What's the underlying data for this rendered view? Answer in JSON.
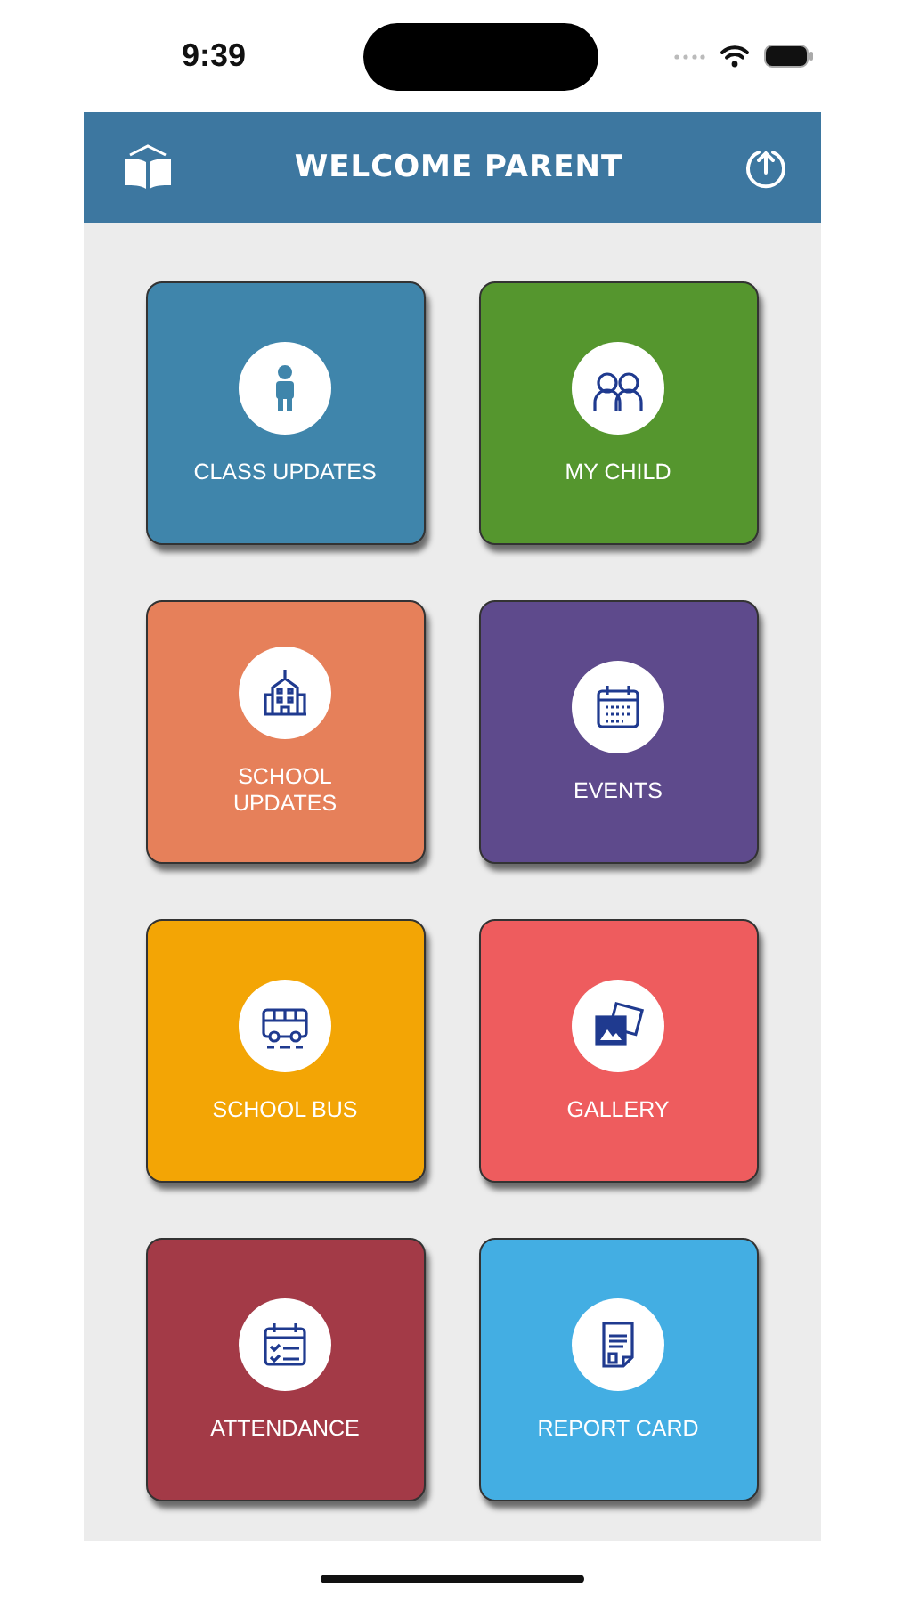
{
  "status_bar": {
    "time": "9:39"
  },
  "header": {
    "title": "WELCOME PARENT"
  },
  "tiles": [
    {
      "label": "CLASS UPDATES",
      "color": "#3f85ab",
      "kind": "child"
    },
    {
      "label": "MY CHILD",
      "color": "#55962e",
      "kind": "kids"
    },
    {
      "label": "SCHOOL UPDATES",
      "color": "#e6805a",
      "kind": "school"
    },
    {
      "label": "EVENTS",
      "color": "#5e4a8c",
      "kind": "calendar"
    },
    {
      "label": "SCHOOL BUS",
      "color": "#f3a505",
      "kind": "bus"
    },
    {
      "label": "GALLERY",
      "color": "#ee5c5e",
      "kind": "gallery"
    },
    {
      "label": "ATTENDANCE",
      "color": "#a33a47",
      "kind": "attendance"
    },
    {
      "label": "REPORT CARD",
      "color": "#43aee3",
      "kind": "report"
    }
  ]
}
